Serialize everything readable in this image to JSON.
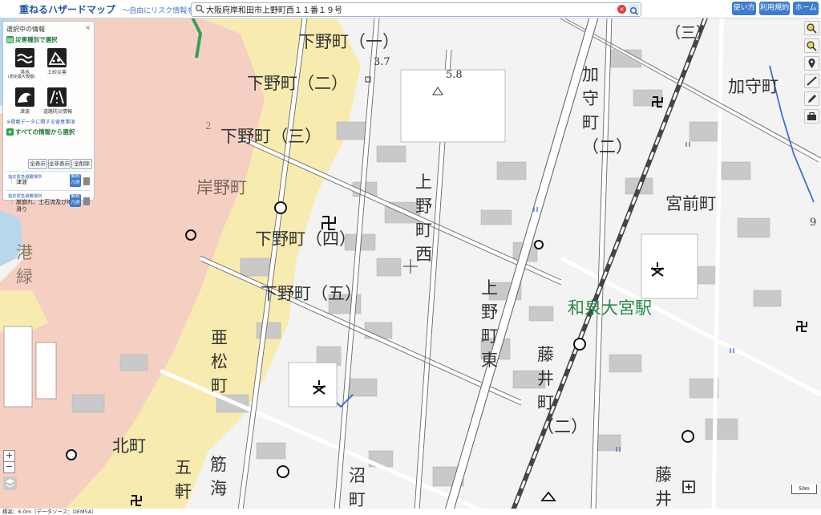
{
  "app": {
    "title": "重ねるハザードマップ",
    "subtitle": "〜自由にリスク情報を調べる〜"
  },
  "search": {
    "value": "大阪府岸和田市上野町西１１番１９号"
  },
  "topnav": {
    "help": "使い方",
    "terms": "利用規約",
    "home": "ホーム"
  },
  "panel": {
    "title": "選択中の情報",
    "close": "×",
    "by_type": "災害種別で選択",
    "hazards": [
      {
        "label": "洪水",
        "sub": "(想定最大規模)"
      },
      {
        "label": "土砂災害",
        "sub": ""
      },
      {
        "label": "津波",
        "sub": ""
      },
      {
        "label": "道路防災情報",
        "sub": ""
      }
    ],
    "note": "※掲載データに関する留意事項",
    "all_info": "すべての情報から選択",
    "buttons": {
      "show_all": "全表示",
      "hide_all": "全非表示",
      "delete_all": "全削除"
    },
    "layers": [
      {
        "type": "指定緊急避難場所",
        "name": "津波",
        "legend": "解説凡例"
      },
      {
        "type": "指定緊急避難場所",
        "name": "崖崩れ、土石流及び地滑り",
        "legend": "解説凡例"
      }
    ]
  },
  "map": {
    "colors": {
      "flood_pink": "#f6cfc3",
      "flood_yellow": "#f7ebaf",
      "water": "#b9d7ec",
      "railway": "#444444",
      "station_green": "#2a8a4a"
    },
    "labels": {
      "shimono_1": "下野町（一）",
      "shimono_2": "下野町（二）",
      "shimono_3": "下野町（三）",
      "shimono_4": "下野町（四）",
      "shimono_5": "下野町（五）",
      "kishino": "岸野町",
      "ueno_nishi": "上野町西",
      "ueno_higashi": "上野町東",
      "kamori_v": "加守町（二）",
      "kamori_h": "加守町",
      "kamori_3": "（三）",
      "miyamae": "宮前町",
      "station": "和泉大宮駅",
      "fujii": "藤井町（二）",
      "fujii2": "藤井",
      "amatsu": "亜松町",
      "kita": "北町",
      "goken": "五軒",
      "sujiumi": "筋海",
      "numa": "沼町",
      "minato": "港緑",
      "elev1": "3.7",
      "elev2": "5.8",
      "elev3": "9",
      "elev4": "2"
    }
  },
  "scale": "50m",
  "status": "標高：6.0m（データソース：DEM5A）",
  "zoom": {
    "in": "+",
    "out": "−"
  }
}
